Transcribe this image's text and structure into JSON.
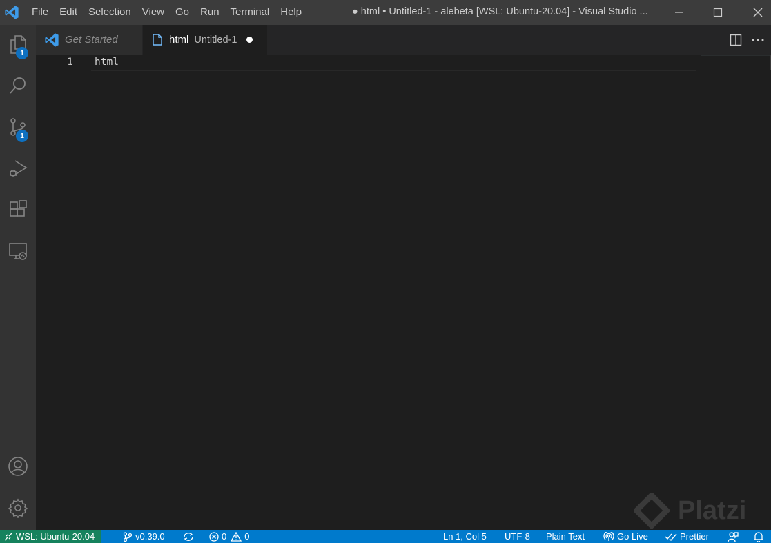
{
  "menu": [
    "File",
    "Edit",
    "Selection",
    "View",
    "Go",
    "Run",
    "Terminal",
    "Help"
  ],
  "window_title": "● html • Untitled-1 - alebeta [WSL: Ubuntu-20.04] - Visual Studio ...",
  "activity_badges": {
    "explorer": "1",
    "source_control": "1"
  },
  "tabs": {
    "get_started": "Get Started",
    "active_name": "html",
    "active_desc": "Untitled-1"
  },
  "editor": {
    "line_number": "1",
    "line_text": "html"
  },
  "watermark": "Platzi",
  "status": {
    "remote": "WSL: Ubuntu-20.04",
    "branch": "v0.39.0",
    "errors": "0",
    "warnings": "0",
    "position": "Ln 1, Col 5",
    "encoding": "UTF-8",
    "language": "Plain Text",
    "go_live": "Go Live",
    "prettier": "Prettier"
  },
  "colors": {
    "status_bar": "#007acc",
    "remote_indicator": "#16825d",
    "badge": "#0e70c0",
    "vscode_logo": "#3e9be9"
  }
}
